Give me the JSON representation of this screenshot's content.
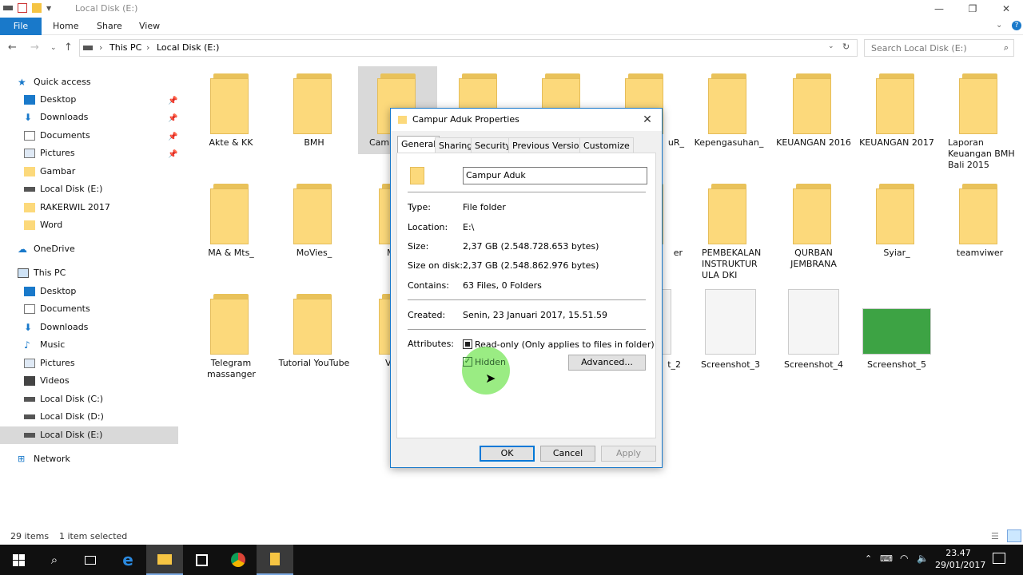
{
  "window": {
    "title": "Local Disk (E:)",
    "min_icon": "minimize-icon",
    "max_icon": "restore-icon",
    "close_icon": "close-icon"
  },
  "ribbon": {
    "tabs": [
      "File",
      "Home",
      "Share",
      "View"
    ]
  },
  "address": {
    "crumbs": [
      "This PC",
      "Local Disk (E:)"
    ],
    "search_placeholder": "Search Local Disk (E:)"
  },
  "sidebar": {
    "quick_access": "Quick access",
    "qa_items": [
      {
        "label": "Desktop",
        "pinned": true
      },
      {
        "label": "Downloads",
        "pinned": true
      },
      {
        "label": "Documents",
        "pinned": true
      },
      {
        "label": "Pictures",
        "pinned": true
      },
      {
        "label": "Gambar",
        "pinned": false
      },
      {
        "label": "Local Disk (E:)",
        "pinned": false
      },
      {
        "label": "RAKERWIL 2017",
        "pinned": false
      },
      {
        "label": "Word",
        "pinned": false
      }
    ],
    "onedrive": "OneDrive",
    "this_pc": "This PC",
    "pc_items": [
      "Desktop",
      "Documents",
      "Downloads",
      "Music",
      "Pictures",
      "Videos",
      "Local Disk (C:)",
      "Local Disk (D:)",
      "Local Disk (E:)"
    ],
    "network": "Network"
  },
  "items": {
    "row1": [
      "Akte & KK",
      "BMH",
      "Camp",
      "",
      "",
      "uR_",
      "Kepengasuhan_",
      "KEUANGAN 2016",
      "KEUANGAN 2017",
      "Laporan Keuangan BMH Bali 2015"
    ],
    "row2": [
      "MA & Mts_",
      "MoVies_",
      "M",
      "",
      "",
      "er",
      "PEMBEKALAN INSTRUKTUR ULA DKI",
      "QURBAN JEMBRANA",
      "Syiar_",
      "teamviwer"
    ],
    "row3": [
      "Telegram massanger",
      "Tutorial YouTube",
      "V",
      "",
      "",
      "t_2",
      "Screenshot_3",
      "Screenshot_4",
      "Screenshot_5"
    ]
  },
  "status": {
    "count": "29 items",
    "selected": "1 item selected"
  },
  "dialog": {
    "title": "Campur Aduk Properties",
    "tabs": [
      "General",
      "Sharing",
      "Security",
      "Previous Versions",
      "Customize"
    ],
    "name": "Campur Aduk",
    "labels": {
      "type": "Type:",
      "location": "Location:",
      "size": "Size:",
      "size_on_disk": "Size on disk:",
      "contains": "Contains:",
      "created": "Created:",
      "attributes": "Attributes:"
    },
    "values": {
      "type": "File folder",
      "location": "E:\\",
      "size": "2,37 GB (2.548.728.653 bytes)",
      "size_on_disk": "2,37 GB (2.548.862.976 bytes)",
      "contains": "63 Files, 0 Folders",
      "created": "Senin, 23 Januari 2017, 15.51.59"
    },
    "readonly_label": "Read-only (Only applies to files in folder)",
    "hidden_label": "Hidden",
    "advanced": "Advanced...",
    "ok": "OK",
    "cancel": "Cancel",
    "apply": "Apply"
  },
  "taskbar": {
    "time": "23.47",
    "date": "29/01/2017"
  }
}
